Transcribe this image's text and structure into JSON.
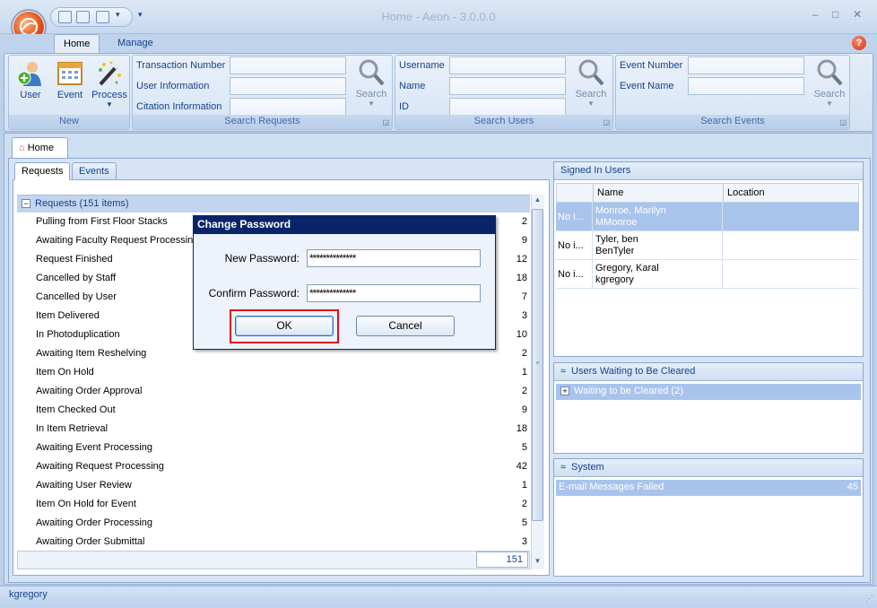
{
  "window": {
    "title": "Home - Aeon - 3.0.0.0",
    "minimize": "–",
    "maximize": "□",
    "close": "✕"
  },
  "quick_access": {
    "dropdown": "▾",
    "customize": "▾"
  },
  "ribbon": {
    "tabs": [
      {
        "label": "Home"
      },
      {
        "label": "Manage"
      }
    ],
    "help": "?",
    "groups": {
      "new": {
        "caption": "New",
        "buttons": [
          {
            "label": "User"
          },
          {
            "label": "Event"
          },
          {
            "label": "Process"
          }
        ]
      },
      "search_requests": {
        "caption": "Search Requests",
        "fields": [
          {
            "label": "Transaction Number",
            "value": ""
          },
          {
            "label": "User Information",
            "value": ""
          },
          {
            "label": "Citation Information",
            "value": ""
          }
        ],
        "search_label": "Search"
      },
      "search_users": {
        "caption": "Search Users",
        "fields": [
          {
            "label": "Username",
            "value": ""
          },
          {
            "label": "Name",
            "value": ""
          },
          {
            "label": "ID",
            "value": ""
          }
        ],
        "search_label": "Search"
      },
      "search_events": {
        "caption": "Search Events",
        "fields": [
          {
            "label": "Event Number",
            "value": ""
          },
          {
            "label": "Event Name",
            "value": ""
          }
        ],
        "search_label": "Search"
      }
    }
  },
  "document_tab": {
    "label": "Home"
  },
  "requests_panel": {
    "tabs": [
      {
        "label": "Requests"
      },
      {
        "label": "Events"
      }
    ],
    "group_header": "Requests  (151 items)",
    "rows": [
      {
        "label": "Pulling from First Floor Stacks",
        "count": "2"
      },
      {
        "label": "Awaiting Faculty Request Processing",
        "count": "9"
      },
      {
        "label": "Request Finished",
        "count": "12"
      },
      {
        "label": "Cancelled by Staff",
        "count": "18"
      },
      {
        "label": "Cancelled by User",
        "count": "7"
      },
      {
        "label": "Item Delivered",
        "count": "3"
      },
      {
        "label": "In Photoduplication",
        "count": "10"
      },
      {
        "label": "Awaiting Item Reshelving",
        "count": "2"
      },
      {
        "label": "Item On Hold",
        "count": "1"
      },
      {
        "label": "Awaiting Order Approval",
        "count": "2"
      },
      {
        "label": "Item Checked Out",
        "count": "9"
      },
      {
        "label": "In Item Retrieval",
        "count": "18"
      },
      {
        "label": "Awaiting Event Processing",
        "count": "5"
      },
      {
        "label": "Awaiting Request Processing",
        "count": "42"
      },
      {
        "label": "Awaiting User Review",
        "count": "1"
      },
      {
        "label": "Item On Hold for Event",
        "count": "2"
      },
      {
        "label": "Awaiting Order Processing",
        "count": "5"
      },
      {
        "label": "Awaiting Order Submittal",
        "count": "3"
      }
    ],
    "total": "151"
  },
  "signed_in": {
    "title": "Signed In Users",
    "columns": [
      "Name",
      "Location"
    ],
    "rows": [
      {
        "col0": "No i...",
        "name": "Monroe, Marilyn",
        "username": "MMonroe",
        "location": ""
      },
      {
        "col0": "No i...",
        "name": "Tyler, ben",
        "username": "BenTyler",
        "location": ""
      },
      {
        "col0": "No i...",
        "name": "Gregory, Karal",
        "username": "kgregory",
        "location": ""
      }
    ]
  },
  "waiting": {
    "title": "Users Waiting to Be Cleared",
    "group": "Waiting to be Cleared (2)"
  },
  "system": {
    "title": "System",
    "item": "E-mail Messages Failed",
    "count": "45"
  },
  "status": {
    "user": "kgregory"
  },
  "dialog": {
    "title": "Change Password",
    "new_label": "New Password:",
    "new_value": "**************",
    "confirm_label": "Confirm Password:",
    "confirm_value": "**************",
    "ok": "OK",
    "cancel": "Cancel"
  },
  "colors": {
    "accent": "#15428b",
    "highlight": "#e3081f",
    "dialog_title": "#0a246a"
  }
}
